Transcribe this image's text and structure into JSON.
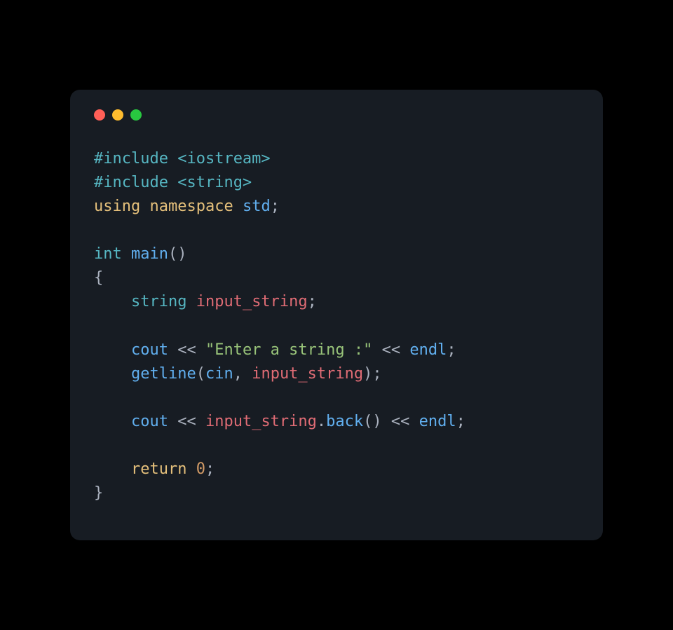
{
  "window": {
    "controls": [
      "close",
      "minimize",
      "zoom"
    ]
  },
  "code": {
    "include1_directive": "#include",
    "include1_header": "<iostream>",
    "include2_directive": "#include",
    "include2_header": "<string>",
    "using_kw": "using",
    "namespace_kw": "namespace",
    "std_ident": "std",
    "semi": ";",
    "int_type": "int",
    "main_ident": "main",
    "lparen": "(",
    "rparen": ")",
    "lbrace": "{",
    "rbrace": "}",
    "string_type": "string",
    "input_var": "input_string",
    "cout_ident": "cout",
    "stream_op": "<<",
    "prompt_str": "\"Enter a string :\"",
    "endl_ident": "endl",
    "getline_ident": "getline",
    "cin_ident": "cin",
    "comma": ",",
    "dot": ".",
    "back_ident": "back",
    "return_kw": "return",
    "zero": "0",
    "indent": "    "
  }
}
